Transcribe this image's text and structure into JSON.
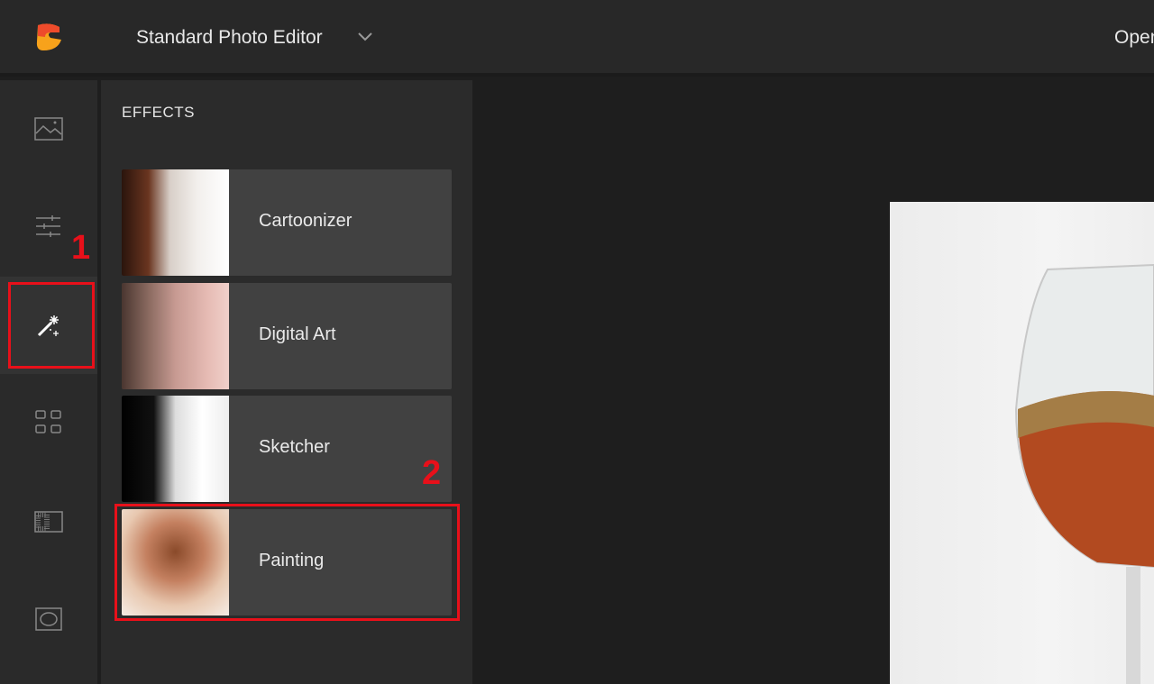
{
  "header": {
    "app_title": "Standard Photo Editor",
    "open_label": "Open",
    "logo": "app-logo"
  },
  "sidebar": {
    "items": [
      {
        "name": "image",
        "icon": "image-icon"
      },
      {
        "name": "adjust",
        "icon": "sliders-icon"
      },
      {
        "name": "effects",
        "icon": "magic-wand-icon",
        "active": true
      },
      {
        "name": "layouts",
        "icon": "grid-icon"
      },
      {
        "name": "texture",
        "icon": "texture-icon"
      },
      {
        "name": "frame",
        "icon": "frame-icon"
      }
    ]
  },
  "panel": {
    "title": "EFFECTS",
    "effects": [
      {
        "label": "Cartoonizer"
      },
      {
        "label": "Digital Art"
      },
      {
        "label": "Sketcher"
      },
      {
        "label": "Painting"
      }
    ]
  },
  "annotations": {
    "step1": "1",
    "step2": "2",
    "color": "#e8101a"
  }
}
